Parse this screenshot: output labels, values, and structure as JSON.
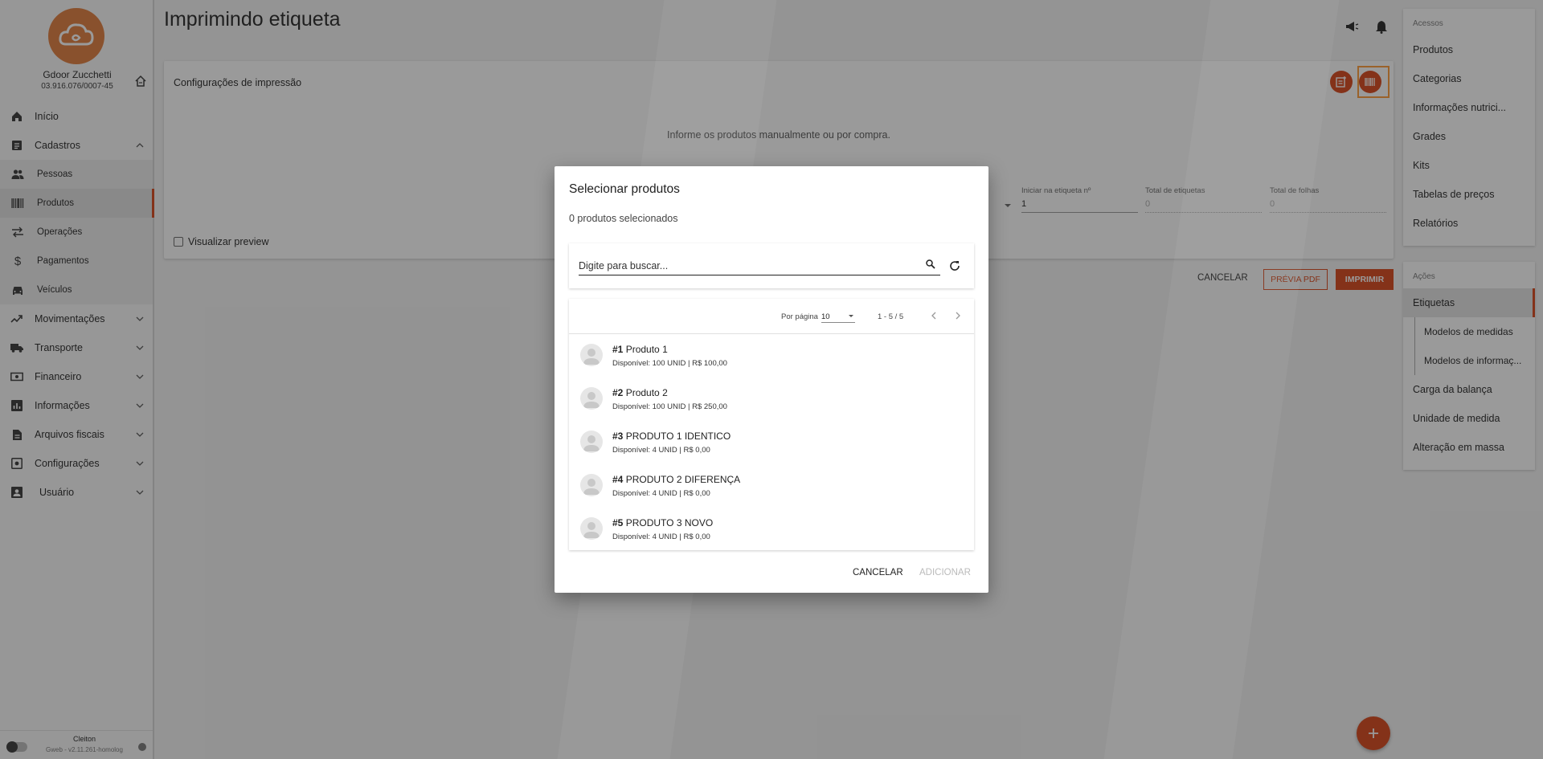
{
  "company": {
    "name": "Gdoor Zucchetti",
    "cnpj": "03.916.076/0007-45"
  },
  "nav": {
    "inicio": "Início",
    "cadastros": "Cadastros",
    "pessoas": "Pessoas",
    "produtos": "Produtos",
    "operacoes": "Operações",
    "pagamentos": "Pagamentos",
    "veiculos": "Veículos",
    "movimentacoes": "Movimentações",
    "transporte": "Transporte",
    "financeiro": "Financeiro",
    "informacoes": "Informações",
    "arquivos_fiscais": "Arquivos fiscais",
    "configuracoes": "Configurações",
    "usuario": "Usuário"
  },
  "footer": {
    "user": "Cleiton",
    "version": "Gweb - v2.11.261-homolog"
  },
  "page": {
    "title": "Imprimindo etiqueta"
  },
  "config": {
    "title": "Configurações de impressão",
    "message": "Informe os produtos manualmente ou por compra.",
    "fields": [
      {
        "label": "Iniciar na etiqueta nº",
        "value": "1"
      },
      {
        "label": "Total de etiquetas",
        "value": "0"
      },
      {
        "label": "Total de folhas",
        "value": "0"
      }
    ],
    "preview_label": "Visualizar preview"
  },
  "actions": {
    "cancel": "CANCELAR",
    "preview_pdf": "PRÉVIA PDF",
    "print": "IMPRIMIR"
  },
  "right_panel": {
    "acessos_title": "Acessos",
    "acessos": [
      "Produtos",
      "Categorias",
      "Informações nutrici...",
      "Grades",
      "Kits",
      "Tabelas de preços",
      "Relatórios"
    ],
    "acoes_title": "Ações",
    "acoes": [
      "Etiquetas",
      "Modelos de medidas",
      "Modelos de informaç...",
      "Carga da balança",
      "Unidade de medida",
      "Alteração em massa"
    ]
  },
  "dialog": {
    "title": "Selecionar produtos",
    "selected_count": "0 produtos selecionados",
    "search_placeholder": "Digite para buscar...",
    "per_page_label": "Por página",
    "per_page_value": "10",
    "range": "1 - 5 / 5",
    "products": [
      {
        "code": "#1",
        "name": "Produto 1",
        "desc": "Disponível: 100 UNID | R$ 100,00"
      },
      {
        "code": "#2",
        "name": "Produto 2",
        "desc": "Disponível: 100 UNID | R$ 250,00"
      },
      {
        "code": "#3",
        "name": "PRODUTO 1 IDENTICO",
        "desc": "Disponível: 4 UNID | R$ 0,00"
      },
      {
        "code": "#4",
        "name": "PRODUTO 2 DIFERENÇA",
        "desc": "Disponível: 4 UNID | R$ 0,00"
      },
      {
        "code": "#5",
        "name": "PRODUTO 3 NOVO",
        "desc": "Disponível: 4 UNID | R$ 0,00"
      }
    ],
    "cancel": "CANCELAR",
    "add": "ADICIONAR"
  },
  "colors": {
    "accent": "#d84315",
    "logo": "#e07b39",
    "highlight": "#ff9933"
  }
}
